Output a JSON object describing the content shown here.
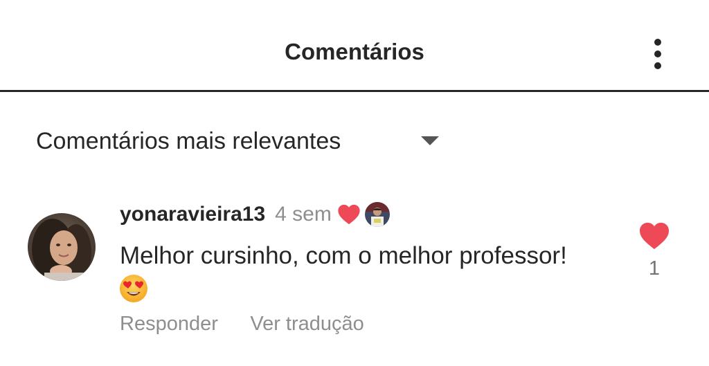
{
  "header": {
    "title": "Comentários",
    "more_icon": "vertical-dots-icon"
  },
  "sort": {
    "label": "Comentários mais relevantes",
    "caret_icon": "caret-down-icon"
  },
  "comments": [
    {
      "username": "yonaravieira13",
      "time": "4 sem",
      "text": "Melhor cursinho, com o melhor professor!",
      "emoji": "heart-eyes-emoji",
      "creator_liked": true,
      "like_count": "1",
      "reply_label": "Responder",
      "translate_label": "Ver tradução"
    }
  ],
  "colors": {
    "text": "#262626",
    "secondary_text": "#8e8e8e",
    "heart": "#ed4956"
  }
}
